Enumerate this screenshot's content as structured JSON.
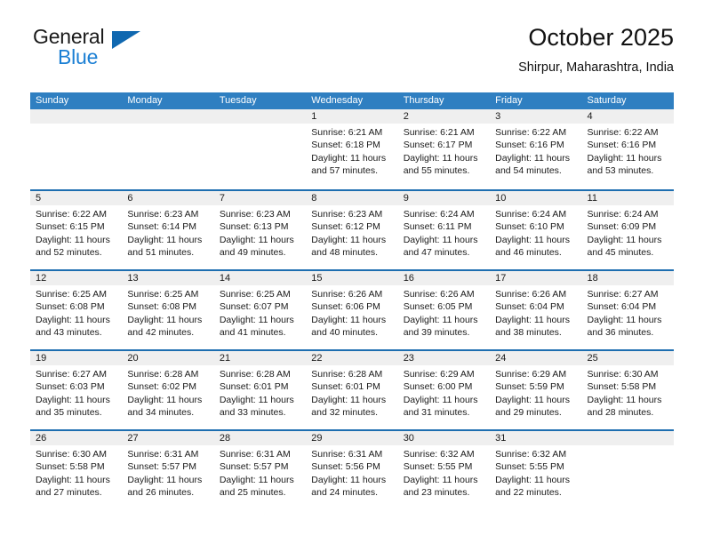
{
  "brand": {
    "word1": "General",
    "word2": "Blue",
    "triangle_color": "#1068b0",
    "blue_color": "#1b7fd4"
  },
  "header": {
    "month_title": "October 2025",
    "location": "Shirpur, Maharashtra, India"
  },
  "theme": {
    "header_bg": "#2f7fc1",
    "row_divider": "#1d6eb0",
    "day_head_bg": "#efefef",
    "text": "#1a1a1a"
  },
  "weekdays": [
    "Sunday",
    "Monday",
    "Tuesday",
    "Wednesday",
    "Thursday",
    "Friday",
    "Saturday"
  ],
  "weeks": [
    [
      {
        "day": ""
      },
      {
        "day": ""
      },
      {
        "day": ""
      },
      {
        "day": "1",
        "sunrise": "Sunrise: 6:21 AM",
        "sunset": "Sunset: 6:18 PM",
        "daylight1": "Daylight: 11 hours",
        "daylight2": "and 57 minutes."
      },
      {
        "day": "2",
        "sunrise": "Sunrise: 6:21 AM",
        "sunset": "Sunset: 6:17 PM",
        "daylight1": "Daylight: 11 hours",
        "daylight2": "and 55 minutes."
      },
      {
        "day": "3",
        "sunrise": "Sunrise: 6:22 AM",
        "sunset": "Sunset: 6:16 PM",
        "daylight1": "Daylight: 11 hours",
        "daylight2": "and 54 minutes."
      },
      {
        "day": "4",
        "sunrise": "Sunrise: 6:22 AM",
        "sunset": "Sunset: 6:16 PM",
        "daylight1": "Daylight: 11 hours",
        "daylight2": "and 53 minutes."
      }
    ],
    [
      {
        "day": "5",
        "sunrise": "Sunrise: 6:22 AM",
        "sunset": "Sunset: 6:15 PM",
        "daylight1": "Daylight: 11 hours",
        "daylight2": "and 52 minutes."
      },
      {
        "day": "6",
        "sunrise": "Sunrise: 6:23 AM",
        "sunset": "Sunset: 6:14 PM",
        "daylight1": "Daylight: 11 hours",
        "daylight2": "and 51 minutes."
      },
      {
        "day": "7",
        "sunrise": "Sunrise: 6:23 AM",
        "sunset": "Sunset: 6:13 PM",
        "daylight1": "Daylight: 11 hours",
        "daylight2": "and 49 minutes."
      },
      {
        "day": "8",
        "sunrise": "Sunrise: 6:23 AM",
        "sunset": "Sunset: 6:12 PM",
        "daylight1": "Daylight: 11 hours",
        "daylight2": "and 48 minutes."
      },
      {
        "day": "9",
        "sunrise": "Sunrise: 6:24 AM",
        "sunset": "Sunset: 6:11 PM",
        "daylight1": "Daylight: 11 hours",
        "daylight2": "and 47 minutes."
      },
      {
        "day": "10",
        "sunrise": "Sunrise: 6:24 AM",
        "sunset": "Sunset: 6:10 PM",
        "daylight1": "Daylight: 11 hours",
        "daylight2": "and 46 minutes."
      },
      {
        "day": "11",
        "sunrise": "Sunrise: 6:24 AM",
        "sunset": "Sunset: 6:09 PM",
        "daylight1": "Daylight: 11 hours",
        "daylight2": "and 45 minutes."
      }
    ],
    [
      {
        "day": "12",
        "sunrise": "Sunrise: 6:25 AM",
        "sunset": "Sunset: 6:08 PM",
        "daylight1": "Daylight: 11 hours",
        "daylight2": "and 43 minutes."
      },
      {
        "day": "13",
        "sunrise": "Sunrise: 6:25 AM",
        "sunset": "Sunset: 6:08 PM",
        "daylight1": "Daylight: 11 hours",
        "daylight2": "and 42 minutes."
      },
      {
        "day": "14",
        "sunrise": "Sunrise: 6:25 AM",
        "sunset": "Sunset: 6:07 PM",
        "daylight1": "Daylight: 11 hours",
        "daylight2": "and 41 minutes."
      },
      {
        "day": "15",
        "sunrise": "Sunrise: 6:26 AM",
        "sunset": "Sunset: 6:06 PM",
        "daylight1": "Daylight: 11 hours",
        "daylight2": "and 40 minutes."
      },
      {
        "day": "16",
        "sunrise": "Sunrise: 6:26 AM",
        "sunset": "Sunset: 6:05 PM",
        "daylight1": "Daylight: 11 hours",
        "daylight2": "and 39 minutes."
      },
      {
        "day": "17",
        "sunrise": "Sunrise: 6:26 AM",
        "sunset": "Sunset: 6:04 PM",
        "daylight1": "Daylight: 11 hours",
        "daylight2": "and 38 minutes."
      },
      {
        "day": "18",
        "sunrise": "Sunrise: 6:27 AM",
        "sunset": "Sunset: 6:04 PM",
        "daylight1": "Daylight: 11 hours",
        "daylight2": "and 36 minutes."
      }
    ],
    [
      {
        "day": "19",
        "sunrise": "Sunrise: 6:27 AM",
        "sunset": "Sunset: 6:03 PM",
        "daylight1": "Daylight: 11 hours",
        "daylight2": "and 35 minutes."
      },
      {
        "day": "20",
        "sunrise": "Sunrise: 6:28 AM",
        "sunset": "Sunset: 6:02 PM",
        "daylight1": "Daylight: 11 hours",
        "daylight2": "and 34 minutes."
      },
      {
        "day": "21",
        "sunrise": "Sunrise: 6:28 AM",
        "sunset": "Sunset: 6:01 PM",
        "daylight1": "Daylight: 11 hours",
        "daylight2": "and 33 minutes."
      },
      {
        "day": "22",
        "sunrise": "Sunrise: 6:28 AM",
        "sunset": "Sunset: 6:01 PM",
        "daylight1": "Daylight: 11 hours",
        "daylight2": "and 32 minutes."
      },
      {
        "day": "23",
        "sunrise": "Sunrise: 6:29 AM",
        "sunset": "Sunset: 6:00 PM",
        "daylight1": "Daylight: 11 hours",
        "daylight2": "and 31 minutes."
      },
      {
        "day": "24",
        "sunrise": "Sunrise: 6:29 AM",
        "sunset": "Sunset: 5:59 PM",
        "daylight1": "Daylight: 11 hours",
        "daylight2": "and 29 minutes."
      },
      {
        "day": "25",
        "sunrise": "Sunrise: 6:30 AM",
        "sunset": "Sunset: 5:58 PM",
        "daylight1": "Daylight: 11 hours",
        "daylight2": "and 28 minutes."
      }
    ],
    [
      {
        "day": "26",
        "sunrise": "Sunrise: 6:30 AM",
        "sunset": "Sunset: 5:58 PM",
        "daylight1": "Daylight: 11 hours",
        "daylight2": "and 27 minutes."
      },
      {
        "day": "27",
        "sunrise": "Sunrise: 6:31 AM",
        "sunset": "Sunset: 5:57 PM",
        "daylight1": "Daylight: 11 hours",
        "daylight2": "and 26 minutes."
      },
      {
        "day": "28",
        "sunrise": "Sunrise: 6:31 AM",
        "sunset": "Sunset: 5:57 PM",
        "daylight1": "Daylight: 11 hours",
        "daylight2": "and 25 minutes."
      },
      {
        "day": "29",
        "sunrise": "Sunrise: 6:31 AM",
        "sunset": "Sunset: 5:56 PM",
        "daylight1": "Daylight: 11 hours",
        "daylight2": "and 24 minutes."
      },
      {
        "day": "30",
        "sunrise": "Sunrise: 6:32 AM",
        "sunset": "Sunset: 5:55 PM",
        "daylight1": "Daylight: 11 hours",
        "daylight2": "and 23 minutes."
      },
      {
        "day": "31",
        "sunrise": "Sunrise: 6:32 AM",
        "sunset": "Sunset: 5:55 PM",
        "daylight1": "Daylight: 11 hours",
        "daylight2": "and 22 minutes."
      },
      {
        "day": ""
      }
    ]
  ]
}
